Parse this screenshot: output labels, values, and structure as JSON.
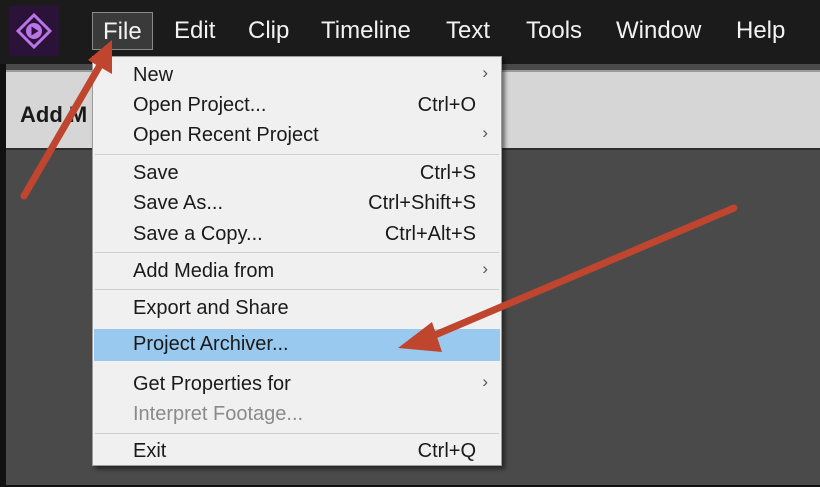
{
  "menubar": {
    "items": [
      {
        "label": "File"
      },
      {
        "label": "Edit"
      },
      {
        "label": "Clip"
      },
      {
        "label": "Timeline"
      },
      {
        "label": "Text"
      },
      {
        "label": "Tools"
      },
      {
        "label": "Window"
      },
      {
        "label": "Help"
      }
    ]
  },
  "panel": {
    "title_partial": "Add M"
  },
  "file_menu": {
    "new": {
      "label": "New"
    },
    "open_project": {
      "label": "Open Project...",
      "shortcut": "Ctrl+O"
    },
    "open_recent": {
      "label": "Open Recent Project"
    },
    "save": {
      "label": "Save",
      "shortcut": "Ctrl+S"
    },
    "save_as": {
      "label": "Save As...",
      "shortcut": "Ctrl+Shift+S"
    },
    "save_copy": {
      "label": "Save a Copy...",
      "shortcut": "Ctrl+Alt+S"
    },
    "add_media": {
      "label": "Add Media from"
    },
    "export_share": {
      "label": "Export and Share"
    },
    "project_archiver": {
      "label": "Project Archiver..."
    },
    "get_properties": {
      "label": "Get Properties for"
    },
    "interpret_footage": {
      "label": "Interpret Footage..."
    },
    "exit": {
      "label": "Exit",
      "shortcut": "Ctrl+Q"
    },
    "submenu_glyph": "›"
  },
  "colors": {
    "menubar_bg": "#1b1b1b",
    "highlight": "#99c9ef",
    "annotation_arrow": "#c0452f",
    "logo_accent": "#b974e8"
  },
  "icons": {
    "app_logo": "premiere-elements-logo-icon"
  }
}
